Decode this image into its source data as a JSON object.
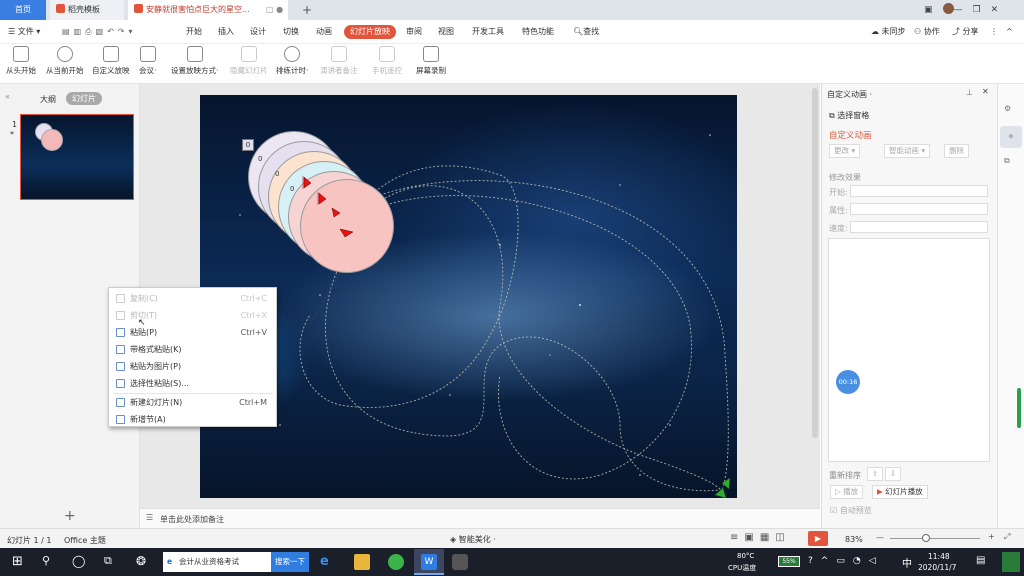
{
  "tabs": [
    {
      "label": "首页"
    },
    {
      "label": "稻壳模板"
    },
    {
      "label": "安静就很害怕点巨大的星空..."
    }
  ],
  "menu": {
    "file": "文件",
    "items": [
      "开始",
      "插入",
      "设计",
      "切换",
      "动画",
      "幻灯片放映",
      "审阅",
      "视图",
      "开发工具",
      "特色功能"
    ],
    "search": "查找",
    "right": [
      "未同步",
      "协作",
      "分享"
    ]
  },
  "ribbon": [
    {
      "label": "从头开始",
      "disabled": false
    },
    {
      "label": "从当前开始",
      "disabled": false
    },
    {
      "label": "自定义放映",
      "disabled": false
    },
    {
      "label": "会议·",
      "disabled": false
    },
    {
      "label": "设置放映方式·",
      "disabled": false
    },
    {
      "label": "隐藏幻灯片",
      "disabled": true
    },
    {
      "label": "排练计时·",
      "disabled": false
    },
    {
      "label": "演讲者备注",
      "disabled": true
    },
    {
      "label": "手机遥控",
      "disabled": true
    },
    {
      "label": "屏幕录制",
      "disabled": false
    }
  ],
  "left_panel": {
    "outline": "大纲",
    "slides": "幻灯片",
    "slide_number": "1",
    "slide_star": "*"
  },
  "slide": {
    "tags": [
      "0",
      "0",
      "0",
      "0"
    ]
  },
  "context_menu": [
    {
      "label": "复制(C)",
      "shortcut": "Ctrl+C",
      "disabled": true
    },
    {
      "label": "剪切(T)",
      "shortcut": "Ctrl+X",
      "disabled": true
    },
    {
      "label": "粘贴(P)",
      "shortcut": "Ctrl+V",
      "disabled": false
    },
    {
      "label": "带格式粘贴(K)",
      "shortcut": "",
      "disabled": false
    },
    {
      "label": "粘贴为图片(P)",
      "shortcut": "",
      "disabled": false
    },
    {
      "label": "选择性粘贴(S)...",
      "shortcut": "",
      "disabled": false
    },
    {
      "label": "新建幻灯片(N)",
      "shortcut": "Ctrl+M",
      "disabled": false
    },
    {
      "label": "新增节(A)",
      "shortcut": "",
      "disabled": false
    }
  ],
  "notes_placeholder": "单击此处添加备注",
  "right_panel": {
    "title": "自定义动画 ·",
    "select_pane": "选择窗格",
    "section": "自定义动画",
    "change": "更改",
    "smart_anim": "智能动画",
    "delete": "删除",
    "modify": "修改效果",
    "start": "开始:",
    "property": "属性:",
    "speed": "速度:",
    "reorder": "重新排序",
    "play": "播放",
    "slideshow": "幻灯片播放",
    "autopreview": "自动预览",
    "timer": "00:16"
  },
  "status": {
    "slide": "幻灯片 1 / 1",
    "theme": "Office 主题",
    "beautify": "智能美化 ·",
    "zoom": "83%"
  },
  "taskbar": {
    "search_text": "会计从业资格考试",
    "search_btn": "搜索一下",
    "temp": "80°C",
    "cpu": "CPU温度",
    "battery": "55%",
    "ime": "中",
    "time": "11:48",
    "date": "2020/11/7"
  },
  "colors": {
    "accent": "#e0553c",
    "home_tab": "#3b7ee3",
    "taskbar": "#1b1f2a"
  }
}
